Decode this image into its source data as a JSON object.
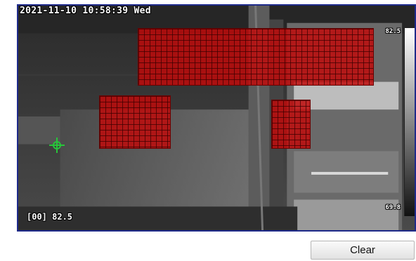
{
  "video": {
    "timestamp": "2021-11-10 10:58:39 Wed",
    "temperature_readout": "[00] 82.5",
    "scale_max": "82.5",
    "scale_min": "69.8"
  },
  "overlay": {
    "region_color": "#c00000"
  },
  "buttons": {
    "clear_label": "Clear"
  }
}
